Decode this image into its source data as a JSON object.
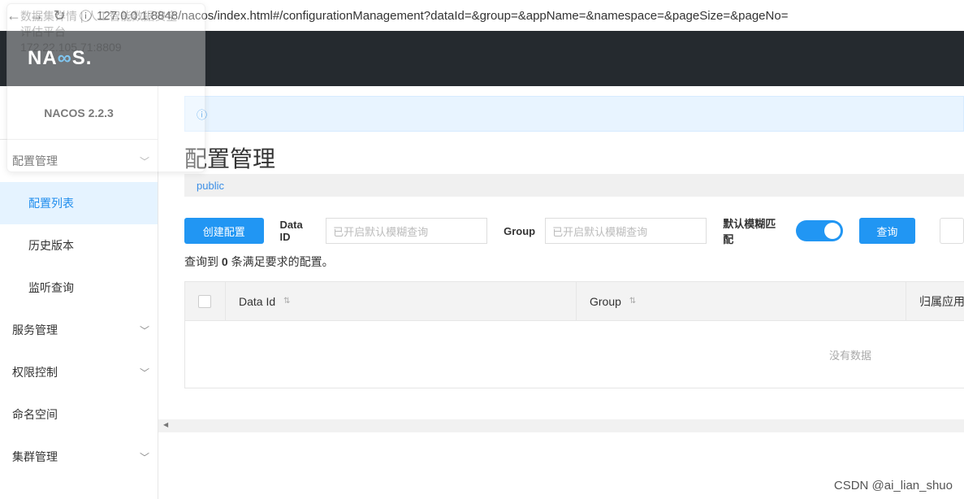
{
  "browser": {
    "url": "127.0.0.1:8848/nacos/index.html#/configurationManagement?dataId=&group=&appName=&namespace=&pageSize=&pageNo="
  },
  "tooltip": {
    "title_line1": "数据集详情 | 人工智能数据安全",
    "title_line2": "评估平台",
    "host": "172.22.105.71:8809"
  },
  "header": {
    "logo": "NACOS."
  },
  "sidebar": {
    "version": "NACOS 2.2.3",
    "items": [
      {
        "label": "配置管理",
        "expandable": true
      },
      {
        "label": "配置列表",
        "active": true
      },
      {
        "label": "历史版本"
      },
      {
        "label": "监听查询"
      },
      {
        "label": "服务管理",
        "expandable": true
      },
      {
        "label": "权限控制",
        "expandable": true
      },
      {
        "label": "命名空间"
      },
      {
        "label": "集群管理",
        "expandable": true
      }
    ]
  },
  "main": {
    "title": "配置管理",
    "namespace": "public",
    "create_button": "创建配置",
    "dataid_label": "Data ID",
    "dataid_placeholder": "已开启默认模糊查询",
    "group_label": "Group",
    "group_placeholder": "已开启默认模糊查询",
    "fuzzy_label": "默认模糊匹配",
    "fuzzy_enabled": true,
    "query_button": "查询",
    "count_prefix": "查询到 ",
    "count": "0",
    "count_suffix": " 条满足要求的配置。",
    "columns": [
      "Data Id",
      "Group",
      "归属应用"
    ],
    "empty": "没有数据"
  },
  "watermark": "CSDN @ai_lian_shuo",
  "colors": {
    "primary": "#2196f3",
    "topbar": "#252a2f"
  }
}
